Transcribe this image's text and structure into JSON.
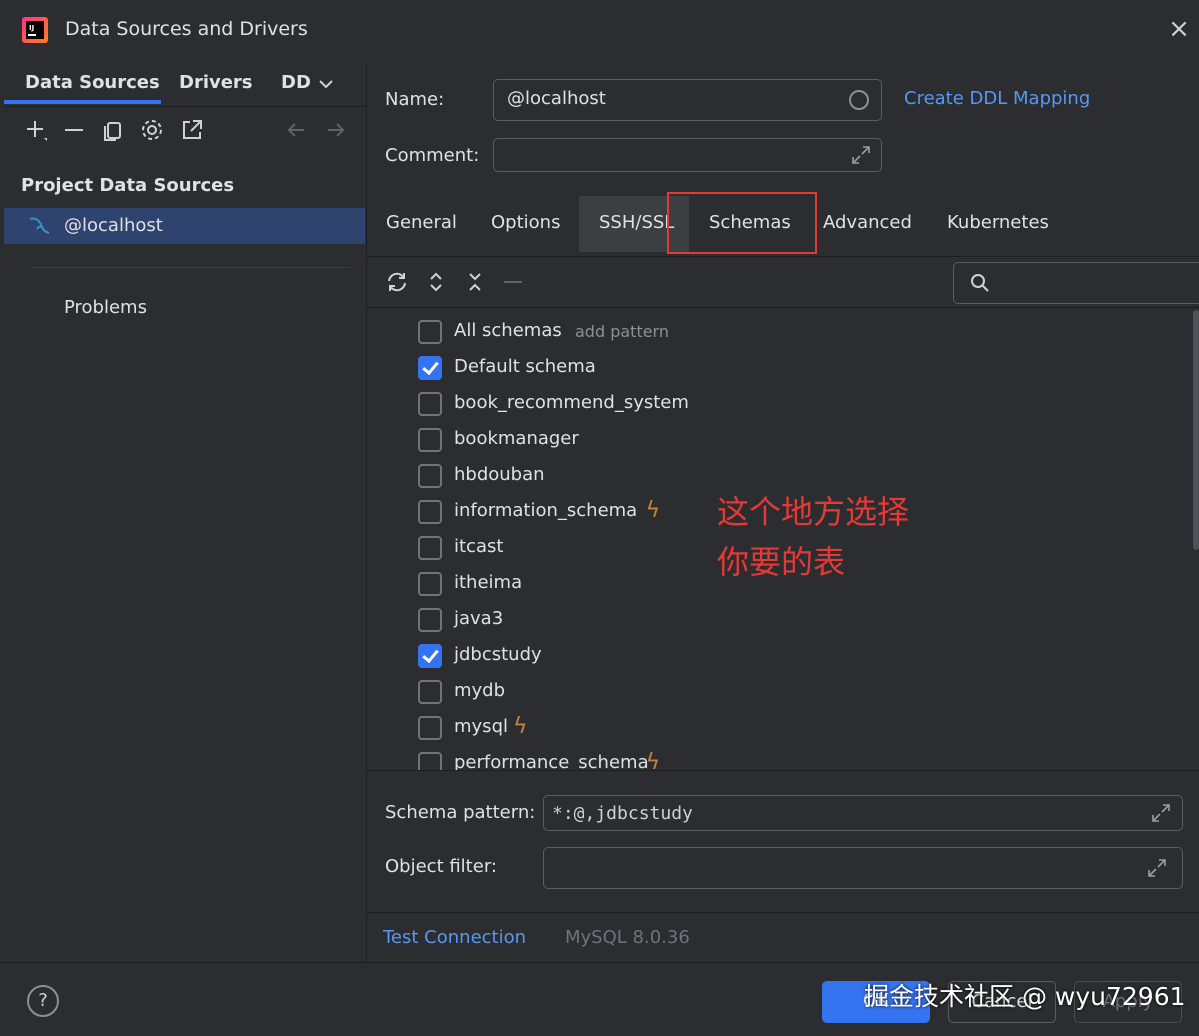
{
  "window": {
    "title": "Data Sources and Drivers",
    "close_icon": "×"
  },
  "left": {
    "tabs": [
      "Data Sources",
      "Drivers",
      "DD"
    ],
    "section_title": "Project Data Sources",
    "data_source": "@localhost",
    "problems": "Problems"
  },
  "form": {
    "name_label": "Name:",
    "name_value": "@localhost",
    "comment_label": "Comment:",
    "comment_value": "",
    "ddl_link": "Create DDL Mapping"
  },
  "tabs": [
    "General",
    "Options",
    "SSH/SSL",
    "Schemas",
    "Advanced",
    "Kubernetes"
  ],
  "schemas": {
    "all_label": "All schemas",
    "add_pattern": "add pattern",
    "items": [
      {
        "label": "Default schema",
        "checked": true,
        "bolt": false
      },
      {
        "label": "book_recommend_system",
        "checked": false,
        "bolt": false
      },
      {
        "label": "bookmanager",
        "checked": false,
        "bolt": false
      },
      {
        "label": "hbdouban",
        "checked": false,
        "bolt": false
      },
      {
        "label": "information_schema",
        "checked": false,
        "bolt": true
      },
      {
        "label": "itcast",
        "checked": false,
        "bolt": false
      },
      {
        "label": "itheima",
        "checked": false,
        "bolt": false
      },
      {
        "label": "java3",
        "checked": false,
        "bolt": false
      },
      {
        "label": "jdbcstudy",
        "checked": true,
        "bolt": false
      },
      {
        "label": "mydb",
        "checked": false,
        "bolt": false
      },
      {
        "label": "mysql",
        "checked": false,
        "bolt": true
      },
      {
        "label": "performance_schema",
        "checked": false,
        "bolt": true
      }
    ]
  },
  "annotation": {
    "line1": "这个地方选择",
    "line2": "你要的表",
    "color": "#e53935"
  },
  "bottom": {
    "pattern_label": "Schema pattern:",
    "pattern_value": "*:@,jdbcstudy",
    "filter_label": "Object filter:",
    "filter_value": ""
  },
  "connection": {
    "test_label": "Test Connection",
    "version": "MySQL 8.0.36"
  },
  "footer": {
    "help": "?",
    "ok": "OK",
    "cancel": "Cancel",
    "apply": "Apply",
    "watermark": "掘金技术社区 @ wyu72961"
  },
  "colors": {
    "accent": "#3574f0",
    "link": "#5897f2",
    "background": "#2b2d30",
    "selection": "#2e436e",
    "bolt": "#c7823e"
  }
}
